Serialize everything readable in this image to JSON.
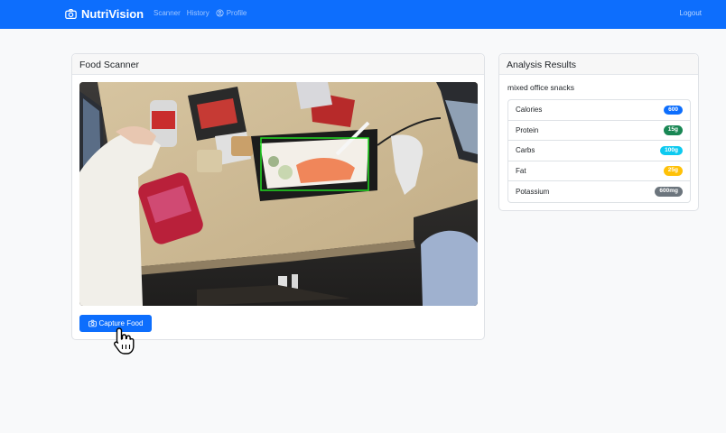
{
  "navbar": {
    "brand": "NutriVision",
    "links": {
      "scanner": "Scanner",
      "history": "History",
      "profile": "Profile"
    },
    "logout": "Logout"
  },
  "scanner": {
    "title": "Food Scanner",
    "capture_label": "Capture Food"
  },
  "results": {
    "title": "Analysis Results",
    "food_name": "mixed office snacks",
    "nutrients": [
      {
        "label": "Calories",
        "value": "600",
        "color": "#0d6efd"
      },
      {
        "label": "Protein",
        "value": "15g",
        "color": "#198754"
      },
      {
        "label": "Carbs",
        "value": "100g",
        "color": "#0dcaf0"
      },
      {
        "label": "Fat",
        "value": "25g",
        "color": "#ffc107"
      },
      {
        "label": "Potassium",
        "value": "600mg",
        "color": "#6c757d"
      }
    ]
  },
  "colors": {
    "primary": "#0d6efd",
    "detection_box": "#22dd22"
  }
}
